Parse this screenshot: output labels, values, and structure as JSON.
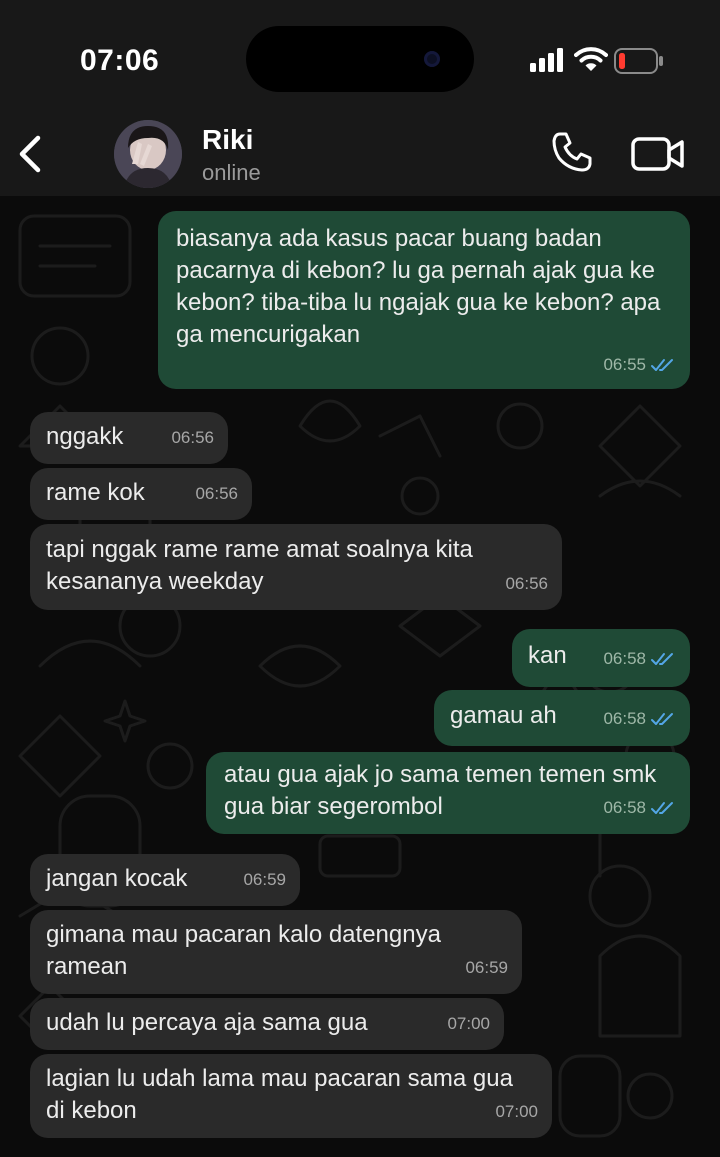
{
  "status": {
    "time": "07:06"
  },
  "contact": {
    "name": "Riki",
    "presence": "online"
  },
  "messages": [
    {
      "dir": "out",
      "text": "biasanya ada kasus pacar buang badan pacarnya di kebon? lu ga pernah ajak gua ke kebon? tiba-tiba lu ngajak gua ke kebon? apa ga mencurigakan",
      "time": "06:55",
      "read": true
    },
    {
      "dir": "in",
      "text": "nggakk",
      "time": "06:56"
    },
    {
      "dir": "in",
      "text": "rame kok",
      "time": "06:56"
    },
    {
      "dir": "in",
      "text": "tapi nggak rame rame amat soalnya kita kesananya weekday",
      "time": "06:56"
    },
    {
      "dir": "out",
      "text": "kan",
      "time": "06:58",
      "read": true
    },
    {
      "dir": "out",
      "text": "gamau ah",
      "time": "06:58",
      "read": true
    },
    {
      "dir": "out",
      "text": "atau gua ajak jo sama temen temen smk gua biar segerombol",
      "time": "06:58",
      "read": true
    },
    {
      "dir": "in",
      "text": "jangan kocak",
      "time": "06:59"
    },
    {
      "dir": "in",
      "text": "gimana mau pacaran kalo datengnya ramean",
      "time": "06:59"
    },
    {
      "dir": "in",
      "text": "udah lu percaya aja sama gua",
      "time": "07:00"
    },
    {
      "dir": "in",
      "text": "lagian lu udah lama mau pacaran sama gua di kebon",
      "time": "07:00"
    }
  ],
  "colors": {
    "outgoing_bubble": "#1f4a36",
    "incoming_bubble": "#2a2a2a",
    "read_ticks": "#53a6e6",
    "background": "#0b0b0b"
  },
  "icons": [
    "back-chevron-icon",
    "phone-icon",
    "video-camera-icon",
    "signal-icon",
    "wifi-icon",
    "battery-low-icon",
    "double-check-icon"
  ]
}
